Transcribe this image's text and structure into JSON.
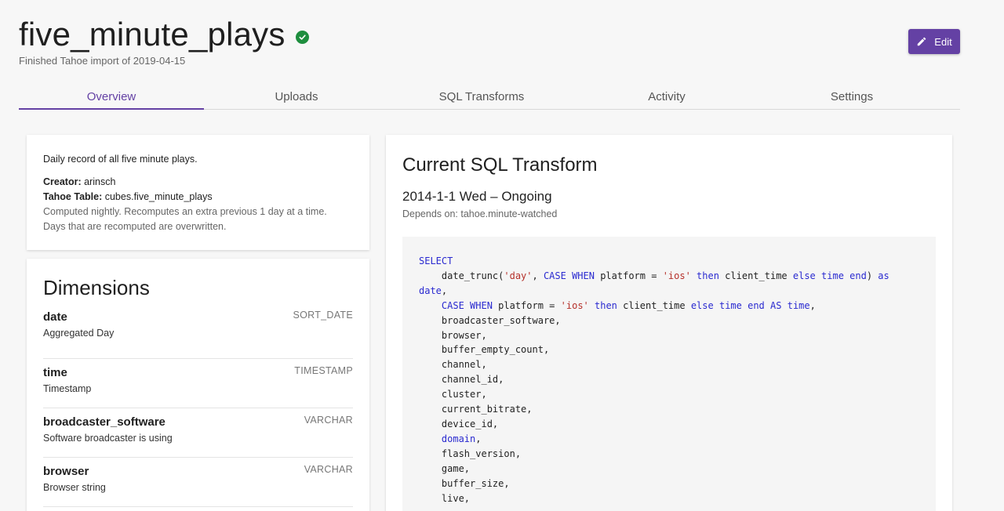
{
  "header": {
    "title": "five_minute_plays",
    "subtitle": "Finished Tahoe import of 2019-04-15",
    "edit_label": "Edit"
  },
  "tabs": [
    {
      "label": "Overview",
      "active": true
    },
    {
      "label": "Uploads",
      "active": false
    },
    {
      "label": "SQL Transforms",
      "active": false
    },
    {
      "label": "Activity",
      "active": false
    },
    {
      "label": "Settings",
      "active": false
    }
  ],
  "info": {
    "description": "Daily record of all five minute plays.",
    "creator_label": "Creator:",
    "creator_value": "arinsch",
    "table_label": "Tahoe Table:",
    "table_value": "cubes.five_minute_plays",
    "schedule_note": "Computed nightly. Recomputes an extra previous 1 day at a time.",
    "overwrite_note": "Days that are recomputed are overwritten."
  },
  "dimensions": {
    "heading": "Dimensions",
    "items": [
      {
        "name": "date",
        "type": "SORT_DATE",
        "description": "Aggregated Day"
      },
      {
        "name": "time",
        "type": "TIMESTAMP",
        "description": "Timestamp"
      },
      {
        "name": "broadcaster_software",
        "type": "VARCHAR",
        "description": "Software broadcaster is using"
      },
      {
        "name": "browser",
        "type": "VARCHAR",
        "description": "Browser string"
      }
    ]
  },
  "sql": {
    "heading": "Current SQL Transform",
    "range": "2014-1-1 Wed – Ongoing",
    "depends": "Depends on: tahoe.minute-watched",
    "code_lines": [
      [
        [
          "kw",
          "SELECT"
        ]
      ],
      [
        [
          "",
          "    date_trunc("
        ],
        [
          "str",
          "'day'"
        ],
        [
          "",
          ", "
        ],
        [
          "kw",
          "CASE WHEN"
        ],
        [
          "",
          " platform = "
        ],
        [
          "str",
          "'ios'"
        ],
        [
          "",
          " "
        ],
        [
          "kw",
          "then"
        ],
        [
          "",
          " client_time "
        ],
        [
          "kw",
          "else"
        ],
        [
          "",
          " "
        ],
        [
          "kw",
          "time"
        ],
        [
          "",
          " "
        ],
        [
          "kw",
          "end"
        ],
        [
          "",
          ") "
        ],
        [
          "kw",
          "as"
        ]
      ],
      [
        [
          "kw",
          "date"
        ],
        [
          "",
          ","
        ]
      ],
      [
        [
          "",
          "    "
        ],
        [
          "kw",
          "CASE WHEN"
        ],
        [
          "",
          " platform = "
        ],
        [
          "str",
          "'ios'"
        ],
        [
          "",
          " "
        ],
        [
          "kw",
          "then"
        ],
        [
          "",
          " client_time "
        ],
        [
          "kw",
          "else"
        ],
        [
          "",
          " "
        ],
        [
          "kw",
          "time"
        ],
        [
          "",
          " "
        ],
        [
          "kw",
          "end"
        ],
        [
          "",
          " "
        ],
        [
          "kw",
          "AS"
        ],
        [
          "",
          " "
        ],
        [
          "kw",
          "time"
        ],
        [
          "",
          ","
        ]
      ],
      [
        [
          "",
          "    broadcaster_software,"
        ]
      ],
      [
        [
          "",
          "    browser,"
        ]
      ],
      [
        [
          "",
          "    buffer_empty_count,"
        ]
      ],
      [
        [
          "",
          "    channel,"
        ]
      ],
      [
        [
          "",
          "    channel_id,"
        ]
      ],
      [
        [
          "",
          "    cluster,"
        ]
      ],
      [
        [
          "",
          "    current_bitrate,"
        ]
      ],
      [
        [
          "",
          "    device_id,"
        ]
      ],
      [
        [
          "",
          "    "
        ],
        [
          "kw",
          "domain"
        ],
        [
          "",
          ","
        ]
      ],
      [
        [
          "",
          "    flash_version,"
        ]
      ],
      [
        [
          "",
          "    game,"
        ]
      ],
      [
        [
          "",
          "    buffer_size,"
        ]
      ],
      [
        [
          "",
          "    live,"
        ]
      ]
    ]
  },
  "colors": {
    "accent": "#6441a4",
    "success": "#1e8e3e",
    "keyword": "#2a2ad0",
    "string": "#b5302a"
  }
}
